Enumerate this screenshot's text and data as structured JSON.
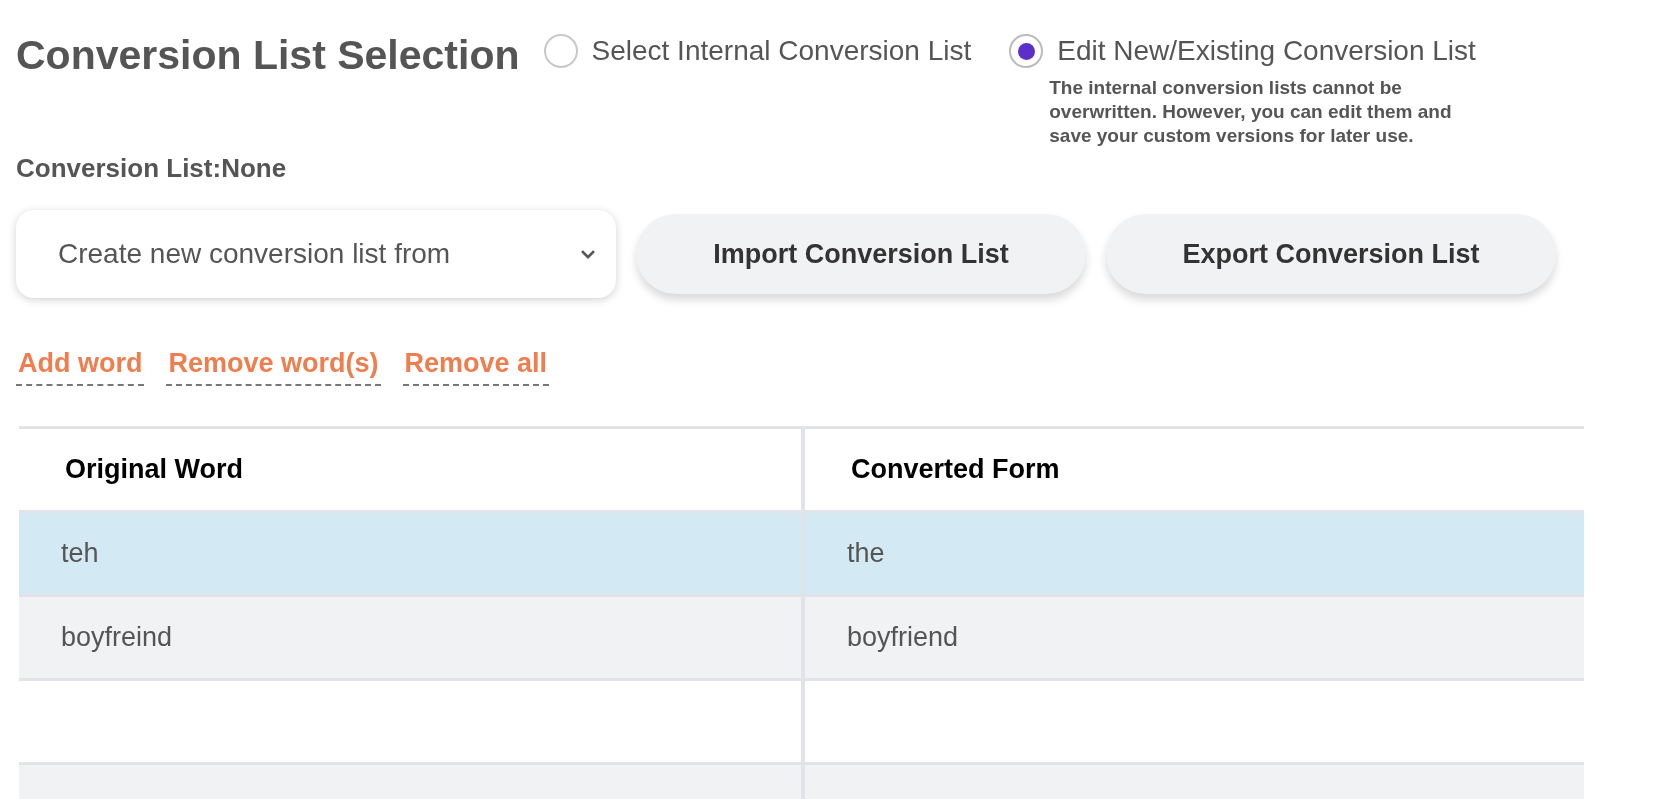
{
  "title": "Conversion List Selection",
  "modes": [
    {
      "label": "Select Internal Conversion List",
      "selected": false
    },
    {
      "label": "Edit New/Existing Conversion List",
      "selected": true,
      "note": "The internal conversion lists cannot be overwritten. However, you can edit them and save your custom versions for later use."
    }
  ],
  "current_list": {
    "label": "Conversion List:",
    "value": "None"
  },
  "dropdown": {
    "value": "Create new conversion list from"
  },
  "buttons": [
    "Import Conversion List",
    "Export Conversion List"
  ],
  "links": [
    "Add word",
    "Remove word(s)",
    "Remove all"
  ],
  "table": {
    "columns": [
      "Original Word",
      "Converted Form"
    ],
    "rows": [
      {
        "cells": [
          "teh",
          "the"
        ],
        "selected": true
      },
      {
        "cells": [
          "boyfreind",
          "boyfriend"
        ],
        "selected": false
      },
      {
        "cells": [],
        "selected": false
      },
      {
        "cells": [],
        "selected": false
      }
    ]
  }
}
